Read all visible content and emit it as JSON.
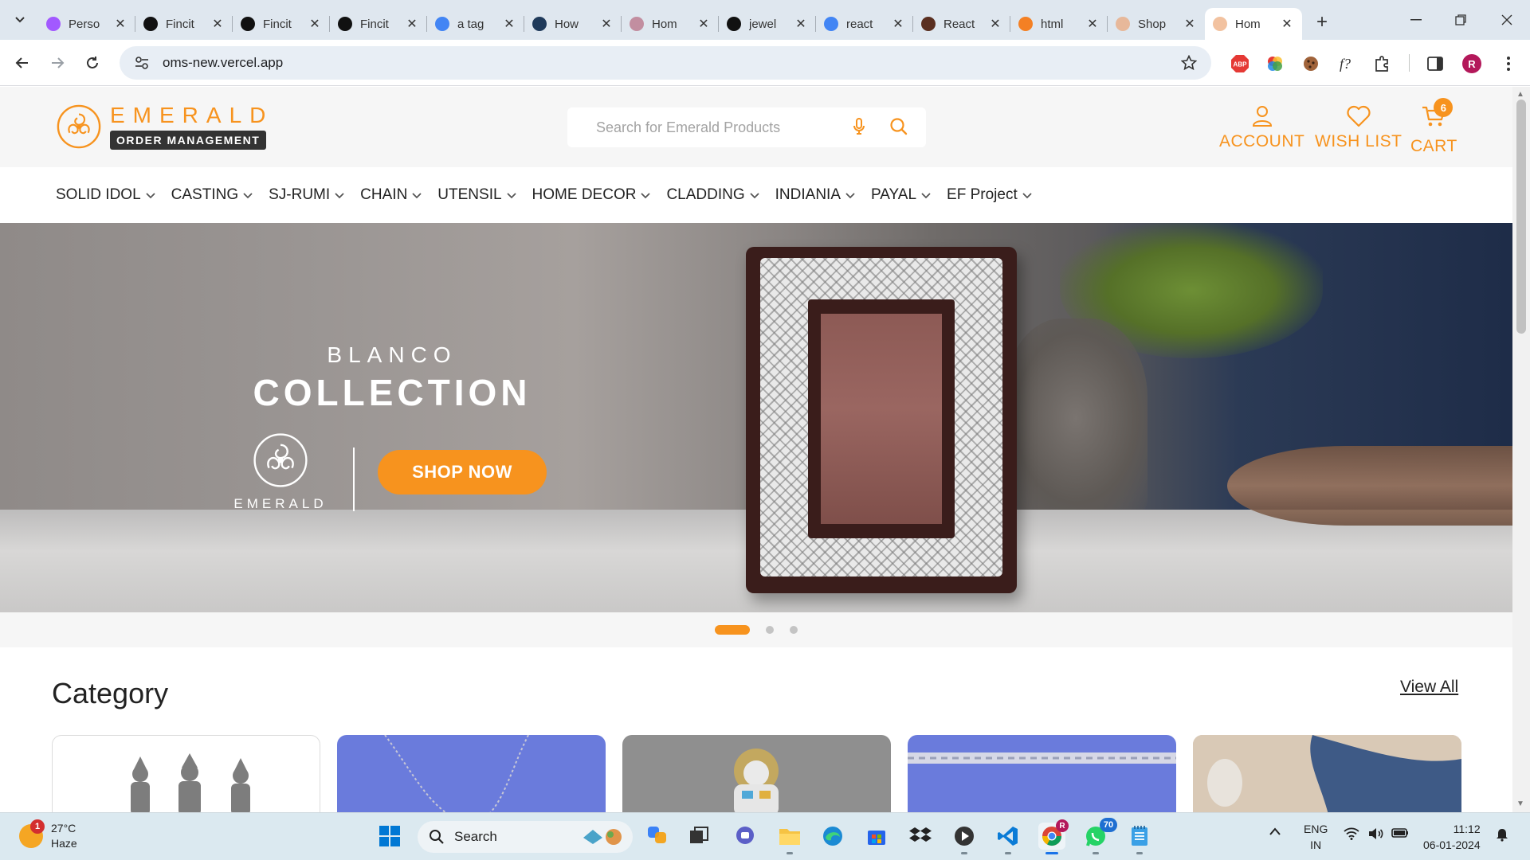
{
  "browser": {
    "tabs": [
      {
        "title": "Perso",
        "favicon": "figma-icon",
        "color": "#a259ff"
      },
      {
        "title": "Fincit",
        "favicon": "fincit-icon",
        "color": "#111111"
      },
      {
        "title": "Fincit",
        "favicon": "fincit-icon",
        "color": "#111111"
      },
      {
        "title": "Fincit",
        "favicon": "fincit-icon",
        "color": "#111111"
      },
      {
        "title": "a tag",
        "favicon": "google-icon",
        "color": "#4285f4"
      },
      {
        "title": "How",
        "favicon": "w3schools-icon",
        "color": "#1f3a5a"
      },
      {
        "title": "Hom",
        "favicon": "site-icon",
        "color": "#c28ea0"
      },
      {
        "title": "jewel",
        "favicon": "github-icon",
        "color": "#111111"
      },
      {
        "title": "react",
        "favicon": "google-icon",
        "color": "#4285f4"
      },
      {
        "title": "React",
        "favicon": "react-icon",
        "color": "#5a2f20"
      },
      {
        "title": "html",
        "favicon": "stackoverflow-icon",
        "color": "#f48024"
      },
      {
        "title": "Shop",
        "favicon": "emerald-icon",
        "color": "#e7b89a"
      },
      {
        "title": "Hom",
        "favicon": "emerald-icon",
        "color": "#f2c2a0",
        "active": true
      }
    ],
    "url": "oms-new.vercel.app",
    "profile_initial": "R"
  },
  "header": {
    "logo_title": "EMERALD",
    "logo_subtitle": "ORDER MANAGEMENT",
    "search_placeholder": "Search for Emerald Products",
    "account_label": "ACCOUNT",
    "wishlist_label": "WISH LIST",
    "cart_label": "CART",
    "cart_count": "6",
    "accent_color": "#f7931e"
  },
  "nav": {
    "items": [
      "SOLID IDOL",
      "CASTING",
      "SJ-RUMI",
      "CHAIN",
      "UTENSIL",
      "HOME DECOR",
      "CLADDING",
      "INDIANIA",
      "PAYAL",
      "EF Project"
    ]
  },
  "hero": {
    "kicker": "BLANCO",
    "title": "COLLECTION",
    "brand": "EMERALD",
    "cta": "SHOP NOW",
    "slides": 3,
    "active_slide": 1
  },
  "category": {
    "heading": "Category",
    "view_all": "View All"
  },
  "taskbar": {
    "temperature": "27°C",
    "condition": "Haze",
    "weather_badge": "1",
    "search_label": "Search",
    "whatsapp_badge": "70",
    "chrome_badge": "R",
    "lang_top": "ENG",
    "lang_bottom": "IN",
    "time": "11:12",
    "date": "06-01-2024"
  }
}
